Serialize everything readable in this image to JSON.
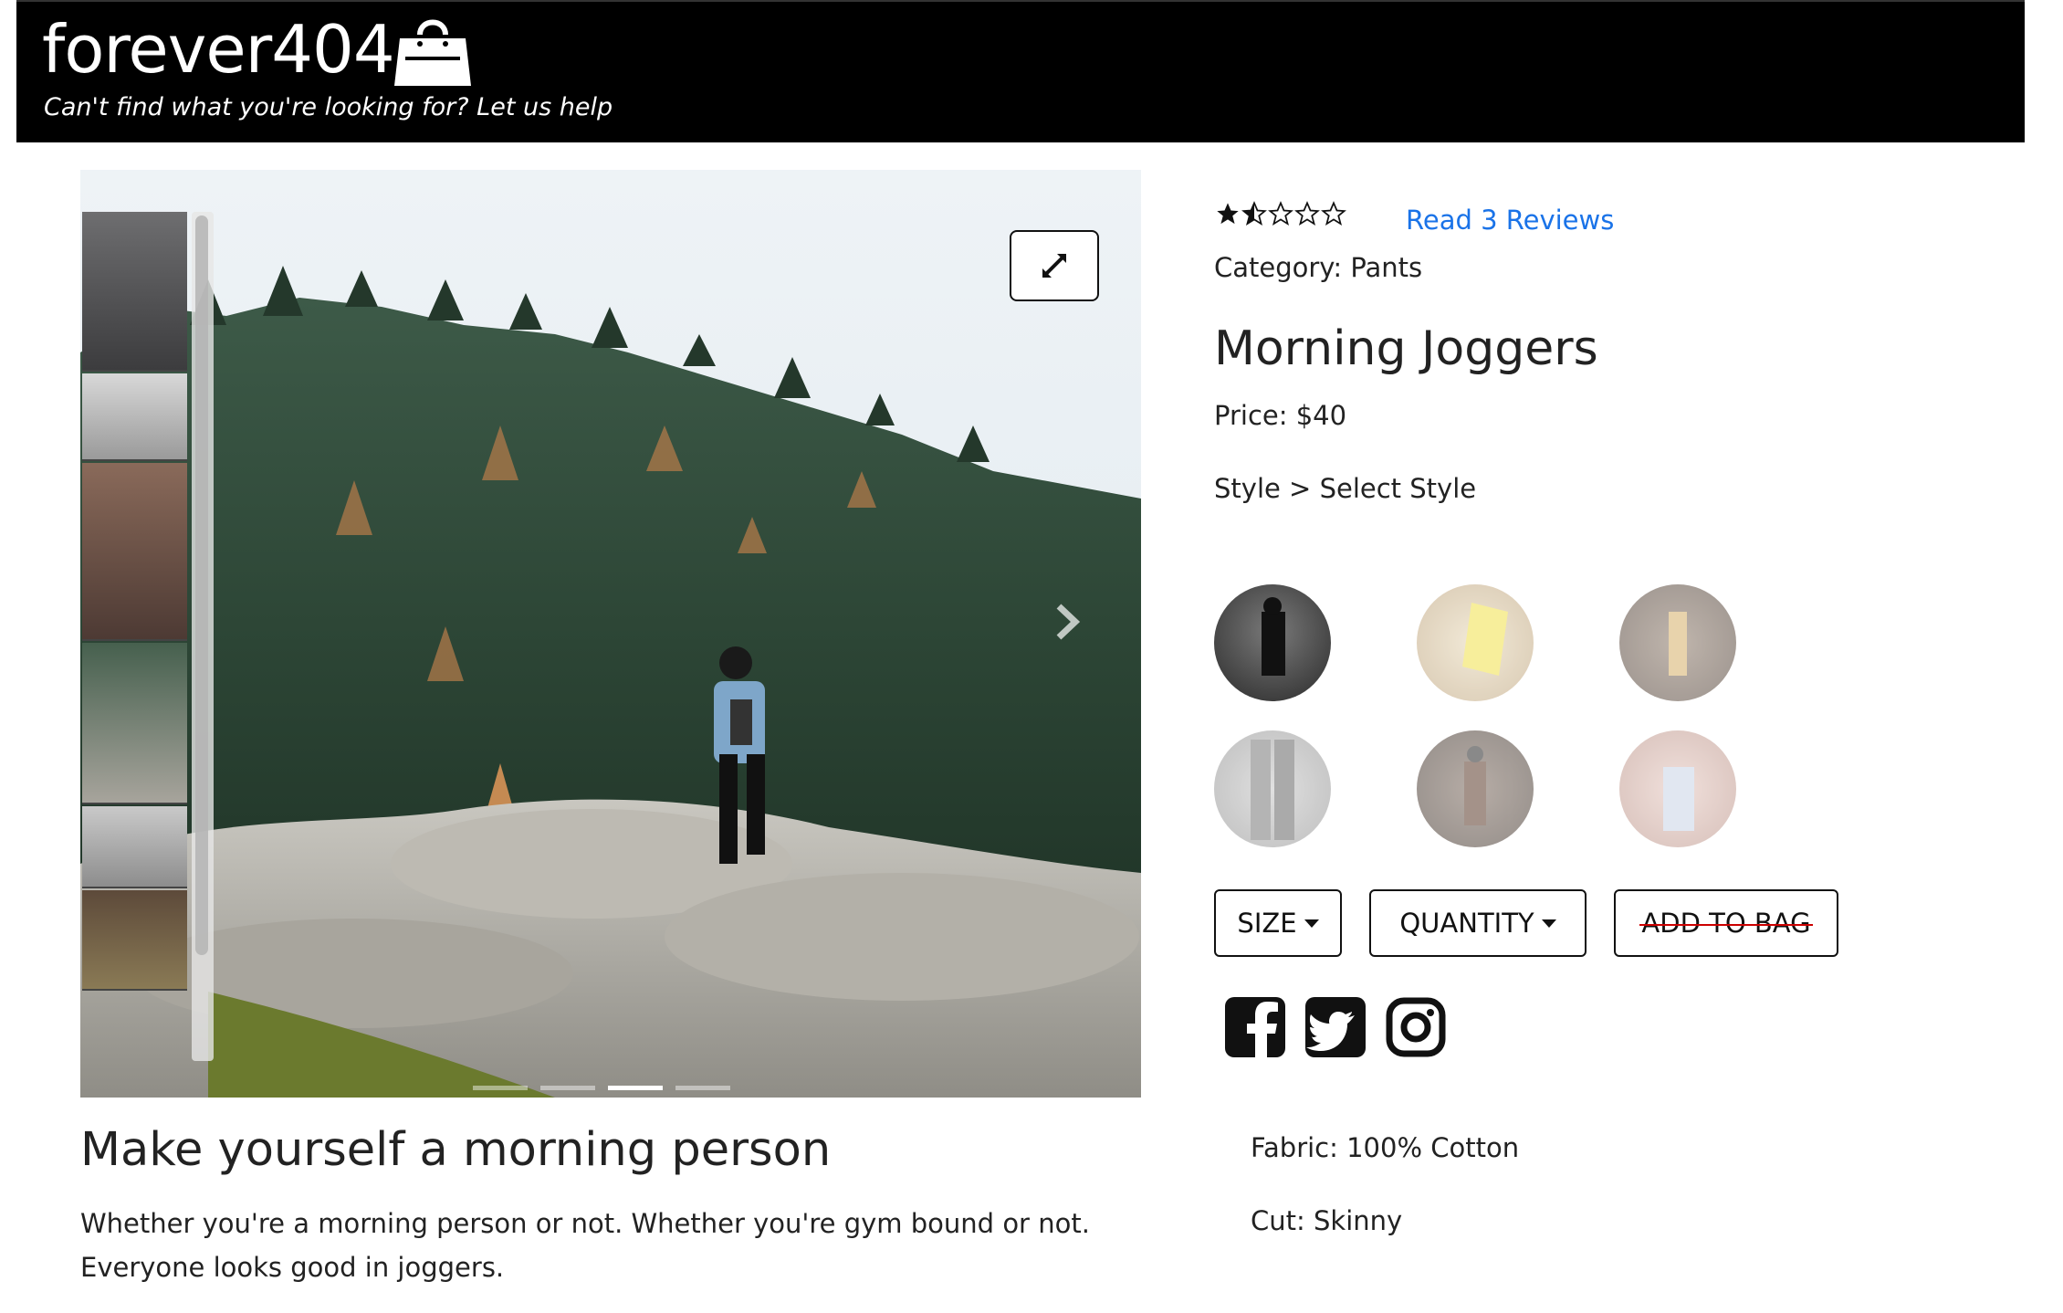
{
  "header": {
    "brand": "forever404",
    "tagline": "Can't find what you're looking for? Let us help"
  },
  "product": {
    "rating": 1.5,
    "rating_max": 5,
    "reviews_link": "Read 3 Reviews",
    "category": "Category: Pants",
    "name": "Morning Joggers",
    "price": "Price: $40",
    "style_line": "Style > Select Style"
  },
  "styles": [
    {
      "name": "style-1",
      "selected": true
    },
    {
      "name": "style-2",
      "selected": false
    },
    {
      "name": "style-3",
      "selected": false
    },
    {
      "name": "style-4",
      "selected": false
    },
    {
      "name": "style-5",
      "selected": false
    },
    {
      "name": "style-6",
      "selected": false
    }
  ],
  "controls": {
    "size_label": "SIZE",
    "quantity_label": "QUANTITY",
    "add_to_bag_label": "ADD TO BAG"
  },
  "social": [
    "facebook-icon",
    "twitter-icon",
    "instagram-icon"
  ],
  "carousel": {
    "thumbnail_count": 6,
    "indicator_count": 4,
    "active_indicator": 2
  },
  "description": {
    "title": "Make yourself a morning person",
    "body": "Whether you're a morning person or not. Whether you're gym bound or not. Everyone looks good in joggers."
  },
  "details": {
    "fabric": "Fabric: 100% Cotton",
    "cut": "Cut: Skinny"
  },
  "colors": {
    "header_bg": "#000000",
    "link": "#1a73e8",
    "strike": "#cc0000"
  }
}
